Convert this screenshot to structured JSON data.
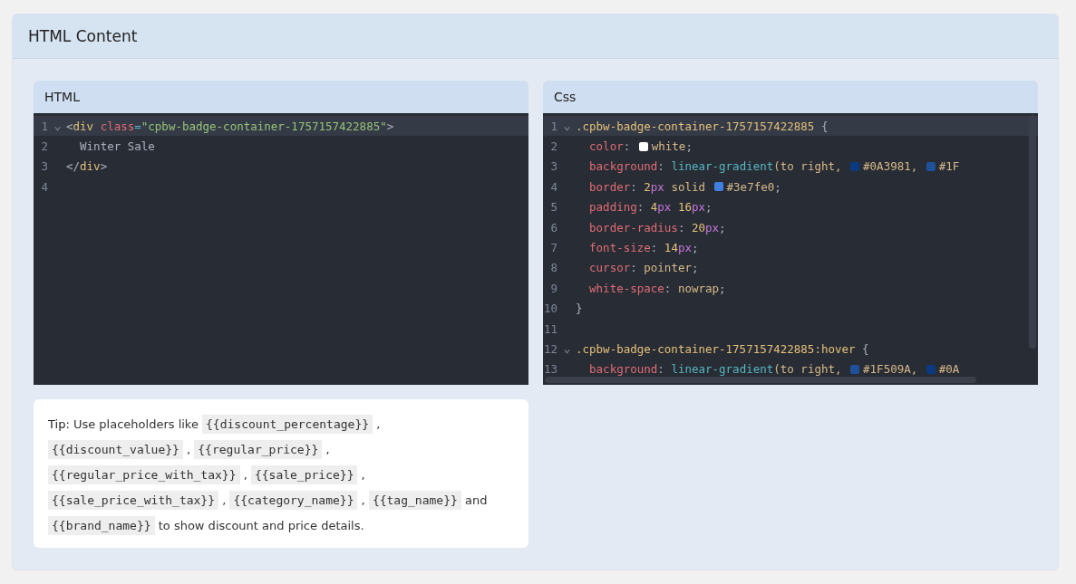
{
  "card": {
    "title": "HTML Content"
  },
  "editors": [
    {
      "title": "HTML",
      "scrollbars": false,
      "lines": [
        {
          "number": "1",
          "fold": true,
          "active": true,
          "tokens": [
            {
              "kind": "punct",
              "t": "<"
            },
            {
              "kind": "tag",
              "t": "div"
            },
            {
              "kind": "attr",
              "t": " class"
            },
            {
              "kind": "op",
              "t": "="
            },
            {
              "kind": "str",
              "t": "\"cpbw-badge-container-1757157422885\""
            },
            {
              "kind": "punct",
              "t": ">"
            }
          ]
        },
        {
          "number": "2",
          "fold": false,
          "active": false,
          "tokens": [
            {
              "kind": "punct",
              "t": "  Winter Sale"
            }
          ]
        },
        {
          "number": "3",
          "fold": false,
          "active": false,
          "tokens": [
            {
              "kind": "punct",
              "t": "</"
            },
            {
              "kind": "tag",
              "t": "div"
            },
            {
              "kind": "punct",
              "t": ">"
            }
          ]
        },
        {
          "number": "4",
          "fold": false,
          "active": false
        }
      ]
    },
    {
      "title": "Css",
      "scrollbars": true,
      "lines": [
        {
          "number": "1",
          "fold": true,
          "active": true,
          "tokens": [
            {
              "kind": "sel",
              "t": ".cpbw-badge-container-1757157422885"
            },
            {
              "kind": "punct",
              "t": " {"
            }
          ]
        },
        {
          "number": "2",
          "fold": false,
          "active": false,
          "tokens": [
            {
              "kind": "prop",
              "t": "  color"
            },
            {
              "kind": "punct",
              "t": ": "
            },
            {
              "kind": "swatch",
              "color": "#ffffff"
            },
            {
              "kind": "val",
              "t": "white"
            },
            {
              "kind": "punct",
              "t": ";"
            }
          ]
        },
        {
          "number": "3",
          "fold": false,
          "active": false,
          "tokens": [
            {
              "kind": "prop",
              "t": "  background"
            },
            {
              "kind": "punct",
              "t": ": "
            },
            {
              "kind": "func",
              "t": "linear-gradient"
            },
            {
              "kind": "val",
              "t": "(to right, "
            },
            {
              "kind": "swatch",
              "color": "#0a3981"
            },
            {
              "kind": "val",
              "t": "#0A3981, "
            },
            {
              "kind": "swatch",
              "color": "#1f509a"
            },
            {
              "kind": "val",
              "t": "#1F"
            }
          ]
        },
        {
          "number": "4",
          "fold": false,
          "active": false,
          "tokens": [
            {
              "kind": "prop",
              "t": "  border"
            },
            {
              "kind": "punct",
              "t": ": "
            },
            {
              "kind": "num",
              "t": "2"
            },
            {
              "kind": "unit",
              "t": "px"
            },
            {
              "kind": "val",
              "t": " solid "
            },
            {
              "kind": "swatch",
              "color": "#3e7fe0"
            },
            {
              "kind": "val",
              "t": "#3e7fe0"
            },
            {
              "kind": "punct",
              "t": ";"
            }
          ]
        },
        {
          "number": "5",
          "fold": false,
          "active": false,
          "tokens": [
            {
              "kind": "prop",
              "t": "  padding"
            },
            {
              "kind": "punct",
              "t": ": "
            },
            {
              "kind": "num",
              "t": "4"
            },
            {
              "kind": "unit",
              "t": "px"
            },
            {
              "kind": "num",
              "t": " 16"
            },
            {
              "kind": "unit",
              "t": "px"
            },
            {
              "kind": "punct",
              "t": ";"
            }
          ]
        },
        {
          "number": "6",
          "fold": false,
          "active": false,
          "tokens": [
            {
              "kind": "prop",
              "t": "  border-radius"
            },
            {
              "kind": "punct",
              "t": ": "
            },
            {
              "kind": "num",
              "t": "20"
            },
            {
              "kind": "unit",
              "t": "px"
            },
            {
              "kind": "punct",
              "t": ";"
            }
          ]
        },
        {
          "number": "7",
          "fold": false,
          "active": false,
          "tokens": [
            {
              "kind": "prop",
              "t": "  font-size"
            },
            {
              "kind": "punct",
              "t": ": "
            },
            {
              "kind": "num",
              "t": "14"
            },
            {
              "kind": "unit",
              "t": "px"
            },
            {
              "kind": "punct",
              "t": ";"
            }
          ]
        },
        {
          "number": "8",
          "fold": false,
          "active": false,
          "tokens": [
            {
              "kind": "prop",
              "t": "  cursor"
            },
            {
              "kind": "punct",
              "t": ": "
            },
            {
              "kind": "val",
              "t": "pointer"
            },
            {
              "kind": "punct",
              "t": ";"
            }
          ]
        },
        {
          "number": "9",
          "fold": false,
          "active": false,
          "tokens": [
            {
              "kind": "prop",
              "t": "  white-space"
            },
            {
              "kind": "punct",
              "t": ": "
            },
            {
              "kind": "val",
              "t": "nowrap"
            },
            {
              "kind": "punct",
              "t": ";"
            }
          ]
        },
        {
          "number": "10",
          "fold": false,
          "active": false,
          "tokens": [
            {
              "kind": "punct",
              "t": "}"
            }
          ]
        },
        {
          "number": "11",
          "fold": false,
          "active": false
        },
        {
          "number": "12",
          "fold": true,
          "active": false,
          "tokens": [
            {
              "kind": "sel",
              "t": ".cpbw-badge-container-1757157422885:hover"
            },
            {
              "kind": "punct",
              "t": " {"
            }
          ]
        },
        {
          "number": "13",
          "fold": false,
          "active": false,
          "tokens": [
            {
              "kind": "prop",
              "t": "  background"
            },
            {
              "kind": "punct",
              "t": ": "
            },
            {
              "kind": "func",
              "t": "linear-gradient"
            },
            {
              "kind": "val",
              "t": "(to right, "
            },
            {
              "kind": "swatch",
              "color": "#1f509a"
            },
            {
              "kind": "val",
              "t": "#1F509A, "
            },
            {
              "kind": "swatch",
              "color": "#0a3981"
            },
            {
              "kind": "val",
              "t": "#0A"
            }
          ]
        }
      ]
    }
  ],
  "tip": [
    {
      "kind": "label",
      "t": "Tip:"
    },
    {
      "kind": "text",
      "t": " Use placeholders like "
    },
    {
      "kind": "code",
      "t": "{{discount_percentage}}"
    },
    {
      "kind": "text",
      "t": " , "
    },
    {
      "kind": "code",
      "t": "{{discount_value}}"
    },
    {
      "kind": "text",
      "t": " , "
    },
    {
      "kind": "code",
      "t": "{{regular_price}}"
    },
    {
      "kind": "text",
      "t": " , "
    },
    {
      "kind": "code",
      "t": "{{regular_price_with_tax}}"
    },
    {
      "kind": "text",
      "t": " , "
    },
    {
      "kind": "code",
      "t": "{{sale_price}}"
    },
    {
      "kind": "text",
      "t": " , "
    },
    {
      "kind": "code",
      "t": "{{sale_price_with_tax}}"
    },
    {
      "kind": "text",
      "t": " , "
    },
    {
      "kind": "code",
      "t": "{{category_name}}"
    },
    {
      "kind": "text",
      "t": " , "
    },
    {
      "kind": "code",
      "t": "{{tag_name}}"
    },
    {
      "kind": "text",
      "t": " and "
    },
    {
      "kind": "code",
      "t": "{{brand_name}}"
    },
    {
      "kind": "text",
      "t": " to show discount and price details."
    }
  ]
}
